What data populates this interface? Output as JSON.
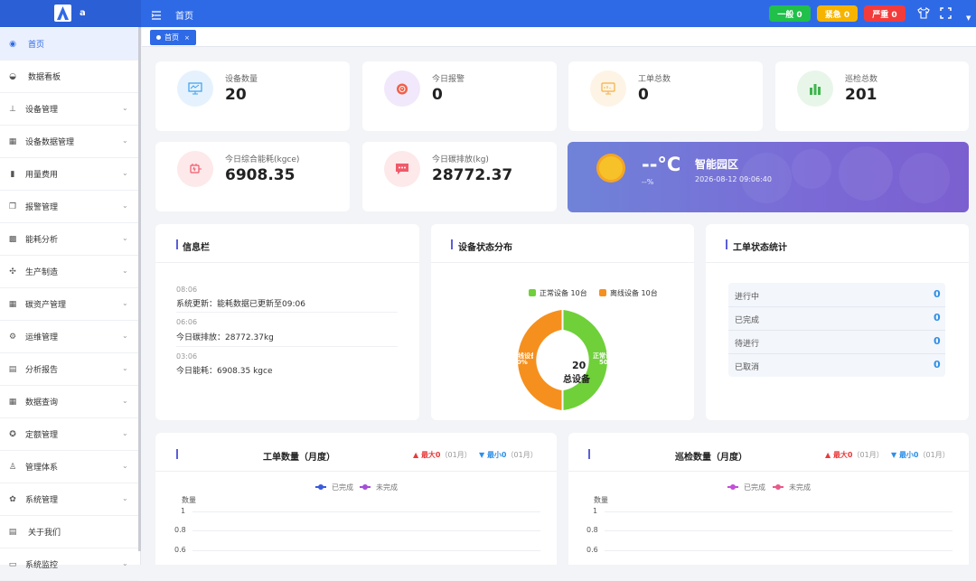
{
  "header": {
    "logo_text": "a",
    "breadcrumb": "首页",
    "alarm_general": "一般 0",
    "alarm_urgent": "紧急 0",
    "alarm_severe": "严重 0"
  },
  "tabs": [
    {
      "label": "首页",
      "close": "×"
    }
  ],
  "sidebar": {
    "items": [
      {
        "label": "首页",
        "icon": "globe-icon"
      },
      {
        "label": "数据看板",
        "icon": "dashboard-icon"
      },
      {
        "label": "设备管理",
        "icon": "sitemap-icon"
      },
      {
        "label": "设备数据管理",
        "icon": "table-icon"
      },
      {
        "label": "用量费用",
        "icon": "book-icon"
      },
      {
        "label": "报警管理",
        "icon": "copy-icon"
      },
      {
        "label": "能耗分析",
        "icon": "grid-icon"
      },
      {
        "label": "生产制造",
        "icon": "move-icon"
      },
      {
        "label": "碳资产管理",
        "icon": "table-icon"
      },
      {
        "label": "运维管理",
        "icon": "tool-icon"
      },
      {
        "label": "分析报告",
        "icon": "file-icon"
      },
      {
        "label": "数据查询",
        "icon": "table-icon"
      },
      {
        "label": "定额管理",
        "icon": "gear-icon"
      },
      {
        "label": "管理体系",
        "icon": "person-icon"
      },
      {
        "label": "系统管理",
        "icon": "gear-icon"
      },
      {
        "label": "关于我们",
        "icon": "file-icon"
      },
      {
        "label": "系统监控",
        "icon": "monitor-icon"
      }
    ]
  },
  "stats": [
    {
      "label": "设备数量",
      "value": "20"
    },
    {
      "label": "今日报警",
      "value": "0"
    },
    {
      "label": "工单总数",
      "value": "0"
    },
    {
      "label": "巡检总数",
      "value": "201"
    },
    {
      "label": "今日综合能耗(kgce)",
      "value": "6908.35"
    },
    {
      "label": "今日碳排放(kg)",
      "value": "28772.37"
    }
  ],
  "weather": {
    "temp": "--°C",
    "humidity": "--%",
    "place": "智能园区",
    "time": "2026-08-12 09:06:40"
  },
  "info_panel": {
    "title": "信息栏",
    "items": [
      {
        "time": "08:06",
        "text": "系统更新：能耗数据已更新至09:06"
      },
      {
        "time": "06:06",
        "text": "今日碳排放：28772.37kg"
      },
      {
        "time": "03:06",
        "text": "今日能耗：6908.35 kgce"
      }
    ]
  },
  "device_panel": {
    "title": "设备状态分布",
    "legend_normal": "正常设备  10台",
    "legend_offline": "离线设备  10台",
    "center_value": "20",
    "center_label": "总设备",
    "label_normal": "正常设备",
    "label_offline": "离线设备",
    "pct_normal": "50%",
    "pct_offline": "50%",
    "colors": {
      "normal": "#6fd03a",
      "offline": "#f5901e"
    }
  },
  "workorder_panel": {
    "title": "工单状态统计",
    "rows": [
      {
        "label": "进行中",
        "value": "0"
      },
      {
        "label": "已完成",
        "value": "0"
      },
      {
        "label": "待进行",
        "value": "0"
      },
      {
        "label": "已取消",
        "value": "0"
      }
    ]
  },
  "chart_left": {
    "title": "工单数量（月度）",
    "max": "▲ 最大0",
    "max_month": "（01月）",
    "min": "▼ 最小0",
    "min_month": "（01月）",
    "legend_done": "已完成",
    "legend_undone": "未完成",
    "ylabel": "数量"
  },
  "chart_right": {
    "title": "巡检数量（月度）",
    "max": "▲ 最大0",
    "max_month": "（01月）",
    "min": "▼ 最小0",
    "min_month": "（01月）",
    "legend_done": "已完成",
    "legend_undone": "未完成",
    "ylabel": "数量"
  },
  "chart_data": [
    {
      "type": "line",
      "title": "工单数量（月度）",
      "ylabel": "数量",
      "y_ticks": [
        "1",
        "0.8",
        "0.6"
      ],
      "series": [
        {
          "name": "已完成",
          "values": []
        },
        {
          "name": "未完成",
          "values": []
        }
      ]
    },
    {
      "type": "line",
      "title": "巡检数量（月度）",
      "ylabel": "数量",
      "y_ticks": [
        "1",
        "0.8",
        "0.6"
      ],
      "series": [
        {
          "name": "已完成",
          "values": []
        },
        {
          "name": "未完成",
          "values": []
        }
      ]
    }
  ]
}
